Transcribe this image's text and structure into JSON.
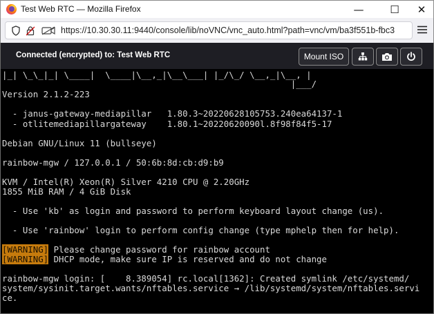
{
  "window": {
    "title": "Test Web RTC — Mozilla Firefox",
    "minimize": "—",
    "maximize": "☐",
    "close": "✕"
  },
  "urlbar": {
    "url": "https://10.30.30.11:9440/console/lib/noVNC/vnc_auto.html?path=vnc/vm/ba3f551b-fbc3"
  },
  "vnc": {
    "status": "Connected (encrypted) to: Test Web RTC",
    "mount_iso_label": "Mount ISO"
  },
  "terminal": {
    "banner_line1": "|_| \\_\\_|_| \\____|  \\____|\\__,_|\\__\\___| |_/\\_/ \\__,_|\\__, |",
    "banner_line2": "                                                        |___/",
    "version": "Version 2.1.2-223",
    "pkg1": "  - janus-gateway-mediapillar   1.80.3~20220628105753.240ea64137-1",
    "pkg2": "  - otlitemediapillargateway    1.80.1~20220620090l.8f98f84f5-17",
    "os": "Debian GNU/Linux 11 (bullseye)",
    "host": "rainbow-mgw / 127.0.0.1 / 50:6b:8d:cb:d9:b9",
    "cpu": "KVM / Intel(R) Xeon(R) Silver 4210 CPU @ 2.20GHz",
    "mem": "1855 MiB RAM / 4 GiB Disk",
    "hint1": "  - Use 'kb' as login and password to perform keyboard layout change (us).",
    "hint2": "  - Use 'rainbow' login to perform config change (type mphelp then for help).",
    "warn_tag": "[WARNING]",
    "warn1": " Please change password for rainbow account",
    "warn2": " DHCP mode, make sure IP is reserved and do not change",
    "login1": "rainbow-mgw login: [    8.389054] rc.local[1362]: Created symlink /etc/systemd/",
    "login2": "system/sysinit.target.wants/nftables.service → /lib/systemd/system/nftables.servi",
    "login3": "ce."
  },
  "colors": {
    "warning_bg": "#c67b0d",
    "terminal_bg": "#000000",
    "vnc_bar_bg": "#1e1e24"
  }
}
